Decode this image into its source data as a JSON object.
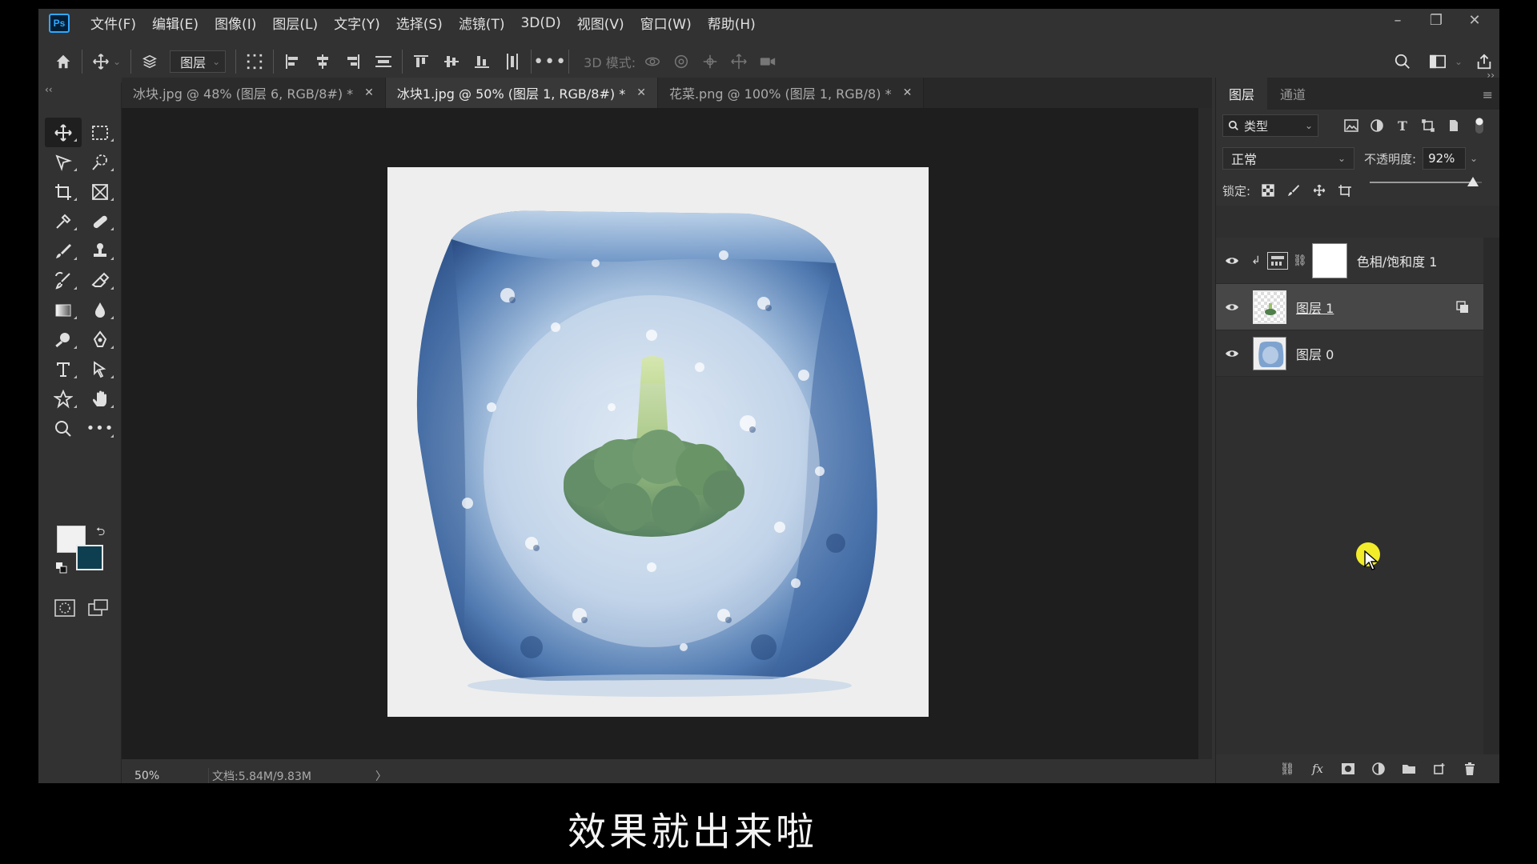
{
  "menubar": {
    "logo": "Ps",
    "items": [
      "文件(F)",
      "编辑(E)",
      "图像(I)",
      "图层(L)",
      "文字(Y)",
      "选择(S)",
      "滤镜(T)",
      "3D(D)",
      "视图(V)",
      "窗口(W)",
      "帮助(H)"
    ],
    "window_controls": [
      "minimize-icon",
      "restore-icon",
      "close-icon"
    ]
  },
  "options": {
    "auto_select_target": "图层",
    "mode_3d_label": "3D 模式:"
  },
  "tabs": [
    {
      "label": "冰块.jpg @ 48% (图层 6, RGB/8#) *",
      "active": false
    },
    {
      "label": "冰块1.jpg @ 50% (图层 1, RGB/8#) *",
      "active": true
    },
    {
      "label": "花菜.png @ 100% (图层 1, RGB/8) *",
      "active": false
    }
  ],
  "status": {
    "zoom": "50%",
    "doc_size": "文档:5.84M/9.83M",
    "arrow": "〉"
  },
  "swatches": {
    "foreground": "#f1f1f1",
    "background": "#0e3f50"
  },
  "layers_panel": {
    "tabs": [
      {
        "label": "图层",
        "active": true
      },
      {
        "label": "通道",
        "active": false
      }
    ],
    "filter_kind": "类型",
    "blend_mode": "正常",
    "opacity_label": "不透明度:",
    "opacity_value": "92%",
    "opacity_fraction": 0.92,
    "lock_label": "锁定:",
    "layers": [
      {
        "name": "色相/饱和度 1",
        "type": "adjustment",
        "clipped": true,
        "visible": true,
        "selected": false
      },
      {
        "name": "图层 1",
        "type": "smart-object",
        "visible": true,
        "selected": true
      },
      {
        "name": "图层 0",
        "type": "pixel",
        "visible": true,
        "selected": false
      }
    ]
  },
  "subtitle": "效果就出来啦",
  "colors": {
    "app_bg": "#323232",
    "canvas_bg": "#1e1e1e",
    "accent": "#31a8ff",
    "cursor_highlight": "#f2ec2a"
  }
}
